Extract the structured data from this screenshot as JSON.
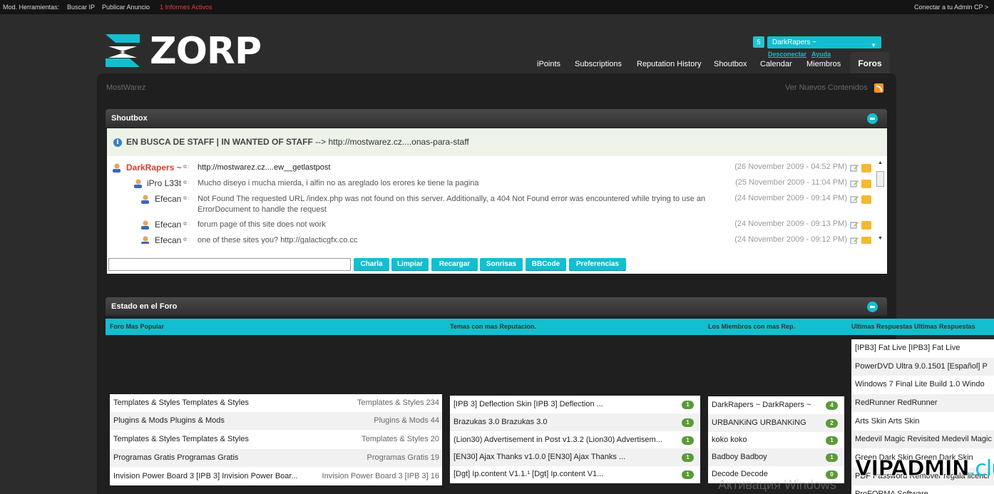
{
  "adminbar": {
    "items": [
      "Mod. Herramientas:",
      "Buscar IP",
      "Publicar Anuncio",
      "1 Informes Activos"
    ],
    "right_link": "Conectar a tu Admin CP >"
  },
  "logo": {
    "text": "ZORP",
    "mark_icon": "zorp-logo-icon"
  },
  "user": {
    "count": "5",
    "name": "DarkRapers ~",
    "links": [
      "Desconectar",
      "Ayuda"
    ]
  },
  "nav": {
    "items": [
      "iPoints",
      "Subscriptions",
      "Reputation History",
      "Shoutbox",
      "Calendar",
      "Miembros"
    ],
    "active": "Foros"
  },
  "breadcrumb": {
    "site": "MostWarez",
    "new_content": "Ver Nuevos Contenidos"
  },
  "shoutbox": {
    "title": "Shoutbox",
    "notice": {
      "bold": "EN BUSCA DE STAFF | IN WANTED OF STAFF",
      "rest": " --> http://mostwarez.cz....onas-para-staff"
    },
    "messages": [
      {
        "user": "DarkRapers ~",
        "text": "http://mostwarez.cz....ew__getlastpost",
        "date": "(26 November 2009 - 04:52 PM)"
      },
      {
        "user": "iPro L33t",
        "text": "Mucho diseyo i mucha mierda, i alfin no as areglado los erores ke tiene la pagina",
        "date": "(25 November 2009 - 11:04 PM)"
      },
      {
        "user": "Efecan",
        "text": "Not Found The requested URL /index.php was not found on this server. Additionally, a 404 Not Found error was encountered while trying to use an",
        "text2": "ErrorDocument to handle the request",
        "date": "(24 November 2009 - 09:14 PM)"
      },
      {
        "user": "Efecan",
        "text": "forum page of this site does not work",
        "date": "(24 November 2009 - 09:13 PM)"
      },
      {
        "user": "Efecan",
        "text": "one of these sites you? http://galacticgfx.co.cc",
        "date": "(24 November 2009 - 09:12 PM)"
      }
    ],
    "buttons": [
      "Charla",
      "Limpiar",
      "Recargar",
      "Sonrisas",
      "BBCode",
      "Preferencias"
    ]
  },
  "stats": {
    "title": "Estado en el Foro",
    "columns": [
      "Foro Mas Popular",
      "Temas con mas Reputacion.",
      "Los Miembros con mas Rep.",
      "Ultimas Respuestas Ultimas Respuestas"
    ],
    "forums": [
      {
        "name": "Templates & Styles Templates & Styles",
        "count": "Templates & Styles 234"
      },
      {
        "name": "Plugins & Mods Plugins & Mods",
        "count": "Plugins & Mods 44"
      },
      {
        "name": "Templates & Styles Templates & Styles",
        "count": "Templates & Styles 20"
      },
      {
        "name": "Programas Gratis Programas Gratis",
        "count": "Programas Gratis 19"
      },
      {
        "name": "Invision Power Board 3 [IPB 3] Invision Power Boar...",
        "count": "Invision Power Board 3 [IPB 3] 16"
      }
    ],
    "topics": [
      {
        "name": "[IPB 3] Deflection Skin [IPB 3] Deflection ...",
        "rep": "1"
      },
      {
        "name": "Brazukas 3.0 Brazukas 3.0",
        "rep": "1"
      },
      {
        "name": "(Lion30) Advertisement in Post v1.3.2 (Lion30) Advertisem...",
        "rep": "1"
      },
      {
        "name": "[EN30] Ajax Thanks v1.0.0 [EN30] Ajax Thanks ...",
        "rep": "1"
      },
      {
        "name": "[Dgt] Ip.content V1.1.¹ [Dgt] Ip.content V1...",
        "rep": "1"
      }
    ],
    "members": [
      {
        "name": "DarkRapers ~ DarkRapers ~",
        "rep": "4"
      },
      {
        "name": "URBANKiNG URBANKiNG",
        "rep": "2"
      },
      {
        "name": "koko koko",
        "rep": "1"
      },
      {
        "name": "Badboy Badboy",
        "rep": "1"
      },
      {
        "name": "Decode Decode",
        "rep": "0"
      }
    ],
    "latest": [
      "[IPB3] Fat Live [IPB3] Fat Live",
      "PowerDVD Ultra 9.0.1501 [Español] P",
      "Windows 7 Final Lite Build 1.0 Windo",
      "RedRunner RedRunner",
      "Arts Skin Arts Skin",
      "Medevil Magic Revisited Medevil Magic",
      "Green Dark Skin Green Dark Skin",
      "PDF Password Remover regala licenci",
      "ProFORMA Software"
    ]
  },
  "overlay": {
    "windows_watermark": "Активация Windows",
    "vip": "VIPADMIN",
    "club": ".club"
  },
  "colors": {
    "accent": "#12bfd1",
    "page_bg": "#2c2c2c",
    "panel_bg": "#1f1f1f",
    "notice_bg": "#eef3ea",
    "badge": "#5a9a3a",
    "username_highlight": "#e03a2e",
    "report_link": "#e04040"
  }
}
